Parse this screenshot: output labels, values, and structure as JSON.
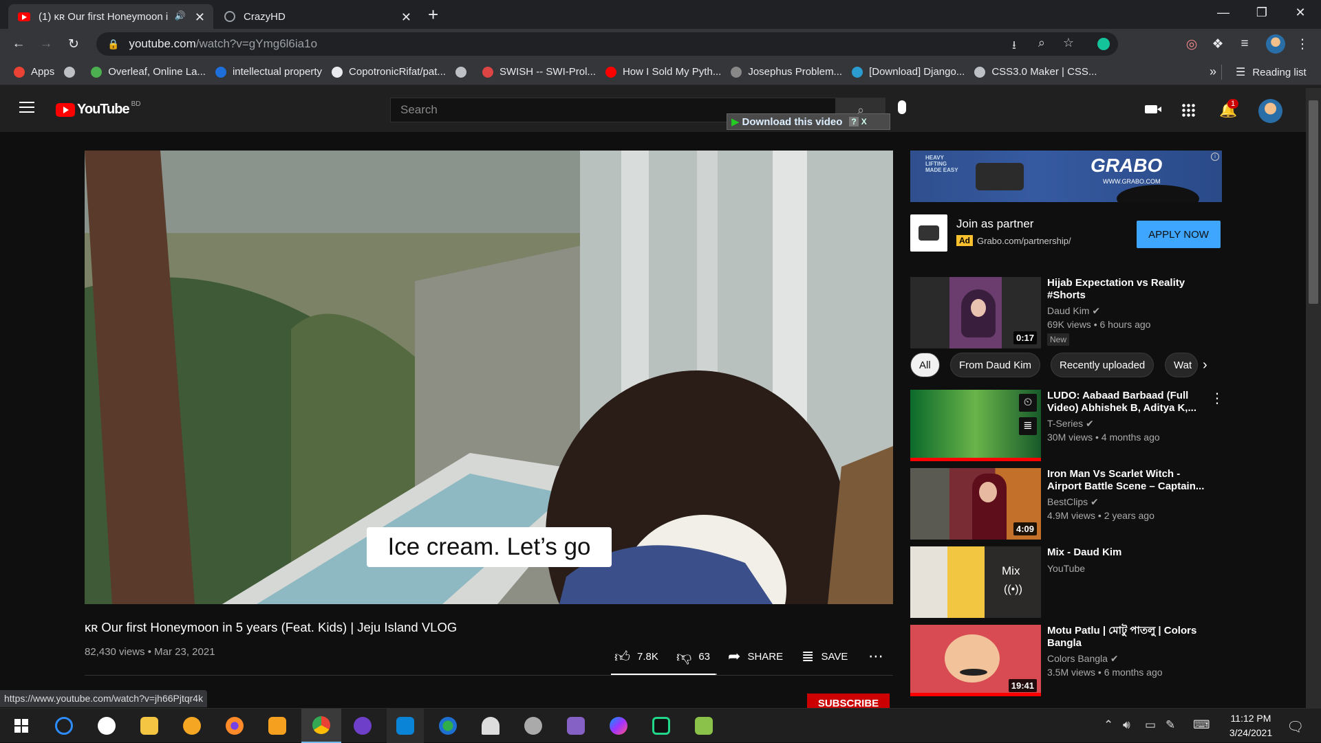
{
  "browser": {
    "tabs": [
      {
        "label": "(1) ᴋʀ Our first Honeymoon i",
        "favicon": "youtube-icon",
        "active": true
      },
      {
        "label": "CrazyHD",
        "favicon": "globe-icon",
        "active": false
      }
    ],
    "new_tab": "+",
    "url_host": "youtube.com",
    "url_path": "/watch?v=gYmg6l6ia1o",
    "bookmarks": [
      {
        "label": "Apps",
        "icon": "apps-grid-icon",
        "color": "#ea4335"
      },
      {
        "label": "",
        "icon": "globe-icon",
        "color": "#bdc1c6"
      },
      {
        "label": "Overleaf, Online La...",
        "icon": "overleaf-icon",
        "color": "#4caf50"
      },
      {
        "label": "intellectual property",
        "icon": "scribd-icon",
        "color": "#1e6fd9"
      },
      {
        "label": "CopotronicRifat/pat...",
        "icon": "github-icon",
        "color": "#e8eaed"
      },
      {
        "label": "",
        "icon": "globe-icon",
        "color": "#bdc1c6"
      },
      {
        "label": "SWISH -- SWI-Prol...",
        "icon": "swish-icon",
        "color": "#d44"
      },
      {
        "label": "How I Sold My Pyth...",
        "icon": "youtube-icon",
        "color": "#f00"
      },
      {
        "label": "Josephus Problem...",
        "icon": "loading-icon",
        "color": "#888"
      },
      {
        "label": "[Download] Django...",
        "icon": "site-icon",
        "color": "#2b9ccf"
      },
      {
        "label": "CSS3.0 Maker | CSS...",
        "icon": "globe-icon",
        "color": "#bdc1c6"
      }
    ],
    "bookmarks_overflow": "»",
    "reading_list": "Reading list",
    "status_url": "https://www.youtube.com/watch?v=jh66Pjtqr4k"
  },
  "youtube": {
    "logo_text": "YouTube",
    "region": "BD",
    "search_placeholder": "Search",
    "notification_count": "1",
    "download_bar": "Download this video",
    "download_help": "?",
    "download_close": "X",
    "caption": "Ice cream. Let’s go",
    "video_title": "ᴋʀ Our first Honeymoon in 5 years (Feat. Kids) | Jeju Island VLOG",
    "views": "82,430 views",
    "date": "Mar 23, 2021",
    "likes": "7.8K",
    "dislikes": "63",
    "like_ratio": 0.99,
    "share": "SHARE",
    "save": "SAVE",
    "subscribe": "SUBSCRIBE"
  },
  "ad": {
    "banner_brand": "GRABO",
    "banner_url": "WWW.GRABO.COM",
    "banner_tag": "HEAVY LIFTING MADE EASY",
    "title": "Join as partner",
    "badge": "Ad",
    "url": "Grabo.com/partnership/",
    "cta": "APPLY NOW"
  },
  "sidebar": {
    "first": {
      "title": "Hijab Expectation vs Reality #Shorts",
      "channel": "Daud Kim",
      "meta": "69K views • 6 hours ago",
      "badge": "New",
      "duration": "0:17"
    },
    "chips": [
      "All",
      "From Daud Kim",
      "Recently uploaded",
      "Wat"
    ],
    "videos": [
      {
        "title": "LUDO: Aabaad Barbaad (Full Video) Abhishek B, Aditya K,...",
        "channel": "T-Series",
        "meta": "30M views • 4 months ago",
        "duration": ""
      },
      {
        "title": "Iron Man Vs Scarlet Witch - Airport Battle Scene – Captain...",
        "channel": "BestClips",
        "meta": "4.9M views • 2 years ago",
        "duration": "4:09"
      },
      {
        "title": "Mix - Daud Kim",
        "channel": "YouTube",
        "meta": "",
        "duration": ""
      },
      {
        "title": "Motu Patlu | মোটু পাতলু | Colors Bangla",
        "channel": "Colors Bangla",
        "meta": "3.5M views • 6 months ago",
        "duration": "19:41"
      }
    ],
    "mix_label": "Mix"
  },
  "taskbar": {
    "time": "11:12 PM",
    "date": "3/24/2021"
  }
}
